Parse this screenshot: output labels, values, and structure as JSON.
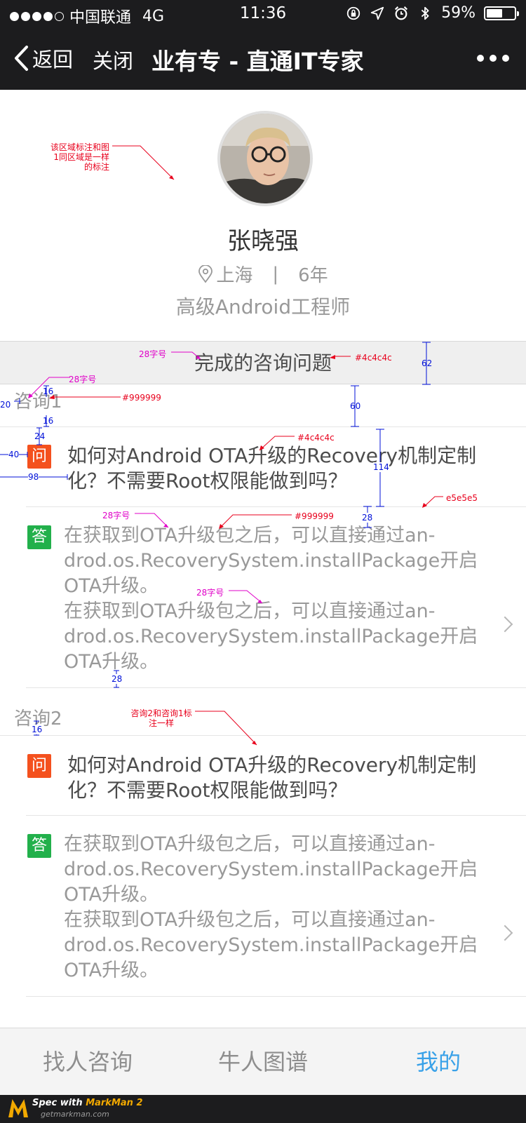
{
  "status_bar": {
    "carrier": "中国联通",
    "network": "4G",
    "time": "11:36",
    "battery": "59%",
    "battery_level": 0.59
  },
  "nav": {
    "back_label": "返回",
    "close_label": "关闭",
    "title": "业有专 - 直通IT专家"
  },
  "profile": {
    "name": "张晓强",
    "location": "上海",
    "divider": "|",
    "years": "6年",
    "job_title": "高级Android工程师"
  },
  "section": {
    "title": "完成的咨询问题"
  },
  "consults": [
    {
      "label": "咨询1",
      "q_badge": "问",
      "question": "如何对Android OTA升级的Recovery机制定制化？不需要Root权限能做到吗？",
      "a_badge": "答",
      "answer": "在获取到OTA升级包之后，可以直接通过an-drod.os.RecoverySystem.installPackage开启OTA升级。\n在获取到OTA升级包之后，可以直接通过an-drod.os.RecoverySystem.installPackage开启OTA升级。"
    },
    {
      "label": "咨询2",
      "q_badge": "问",
      "question": "如何对Android OTA升级的Recovery机制定制化？不需要Root权限能做到吗？",
      "a_badge": "答",
      "answer": "在获取到OTA升级包之后，可以直接通过an-drod.os.RecoverySystem.installPackage开启OTA升级。\n在获取到OTA升级包之后，可以直接通过an-drod.os.RecoverySystem.installPackage开启OTA升级。"
    }
  ],
  "tabs": [
    {
      "label": "找人咨询",
      "active": false
    },
    {
      "label": "牛人图谱",
      "active": false
    },
    {
      "label": "我的",
      "active": true
    }
  ],
  "annotations": {
    "profile_note": "该区域标注和图1同区域是一样的标注",
    "size_28_a": "28字号",
    "color_4c_a": "#4c4c4c",
    "dim_62": "62",
    "size_28_b": "28字号",
    "dim_16_a": "16",
    "color_999_a": "#999999",
    "dim_20": "20",
    "dim_60": "60",
    "dim_16_b": "16",
    "dim_24": "24",
    "color_4c_b": "#4c4c4c",
    "dim_40": "40",
    "dim_114": "114",
    "dim_98": "98",
    "color_e5": "e5e5e5",
    "size_28_c": "28字号",
    "color_999_b": "#999999",
    "dim_28_a": "28",
    "size_28_d": "28字号",
    "dim_28_b": "28",
    "consult2_note": "咨询2和咨询1标注一样",
    "dim_16_c": "16"
  },
  "footer": {
    "brand_prefix": "Spec with ",
    "brand_name": "MarkMan 2",
    "site": "getmarkman.com"
  },
  "colors": {
    "nav_bg": "#1c1c1e",
    "question_badge": "#f4511e",
    "answer_badge": "#22b04b",
    "active_tab": "#39a1e8",
    "text_dark": "#4c4c4c",
    "text_gray": "#999999",
    "divider": "#e5e5e5"
  }
}
